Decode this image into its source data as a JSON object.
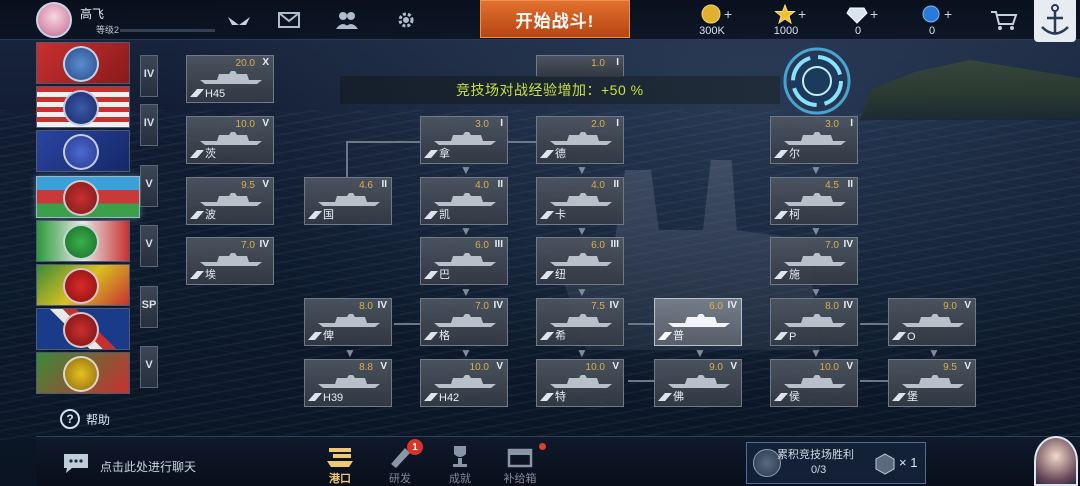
{
  "player": {
    "name": "高飞",
    "level": "等级2"
  },
  "topbar": {
    "start_battle": "开始战斗!",
    "currencies": [
      {
        "icon": "gold-coin-icon",
        "value": "300K"
      },
      {
        "icon": "star-icon",
        "value": "1000"
      },
      {
        "icon": "diamond-icon",
        "value": "0"
      },
      {
        "icon": "blue-gem-icon",
        "value": "0"
      }
    ],
    "plus": "+"
  },
  "notice": {
    "text": "竞技场对战经验增加：+50 %"
  },
  "tier_tabs": [
    "IV",
    "IV",
    "V",
    "V",
    "SP",
    "V"
  ],
  "ships": [
    {
      "level": "20.0",
      "tier": "X",
      "name": "H45"
    },
    {
      "level": "10.0",
      "tier": "V",
      "name": "茨"
    },
    {
      "level": "9.5",
      "tier": "V",
      "name": "波"
    },
    {
      "level": "7.0",
      "tier": "IV",
      "name": "埃"
    },
    {
      "level": "1.0",
      "tier": "I",
      "name": ""
    },
    {
      "level": "3.0",
      "tier": "I",
      "name": "拿"
    },
    {
      "level": "2.0",
      "tier": "I",
      "name": "德"
    },
    {
      "level": "3.0",
      "tier": "I",
      "name": "尔"
    },
    {
      "level": "4.6",
      "tier": "II",
      "name": "国"
    },
    {
      "level": "4.0",
      "tier": "II",
      "name": "凯"
    },
    {
      "level": "4.0",
      "tier": "II",
      "name": "卡"
    },
    {
      "level": "4.5",
      "tier": "II",
      "name": "柯"
    },
    {
      "level": "6.0",
      "tier": "III",
      "name": "巴"
    },
    {
      "level": "6.0",
      "tier": "III",
      "name": "纽"
    },
    {
      "level": "7.0",
      "tier": "IV",
      "name": "施"
    },
    {
      "level": "8.0",
      "tier": "IV",
      "name": "俾"
    },
    {
      "level": "7.0",
      "tier": "IV",
      "name": "格"
    },
    {
      "level": "7.5",
      "tier": "IV",
      "name": "希"
    },
    {
      "level": "6.0",
      "tier": "IV",
      "name": "普"
    },
    {
      "level": "8.0",
      "tier": "IV",
      "name": "P"
    },
    {
      "level": "9.0",
      "tier": "V",
      "name": "O"
    },
    {
      "level": "8.8",
      "tier": "V",
      "name": "H39"
    },
    {
      "level": "10.0",
      "tier": "V",
      "name": "H42"
    },
    {
      "level": "10.0",
      "tier": "V",
      "name": "特"
    },
    {
      "level": "9.0",
      "tier": "V",
      "name": "佛"
    },
    {
      "level": "10.0",
      "tier": "V",
      "name": "侯"
    },
    {
      "level": "9.5",
      "tier": "V",
      "name": "堡"
    }
  ],
  "help": "帮助",
  "bottom": {
    "chat_placeholder": "点击此处进行聊天",
    "nav": [
      {
        "label": "港口",
        "icon": "harbor-icon"
      },
      {
        "label": "研发",
        "icon": "research-icon"
      },
      {
        "label": "成就",
        "icon": "achievement-icon"
      },
      {
        "label": "补给箱",
        "icon": "supply-box-icon"
      }
    ],
    "badge": "1",
    "task": {
      "title": "累积竞技场胜利",
      "progress": "0/3",
      "reward": "× 1"
    }
  },
  "colors": {
    "accent_orange": "#d25a20",
    "level_gold": "#d9b04a",
    "notice_green": "#c9e23a",
    "badge_red": "#d8342a"
  }
}
